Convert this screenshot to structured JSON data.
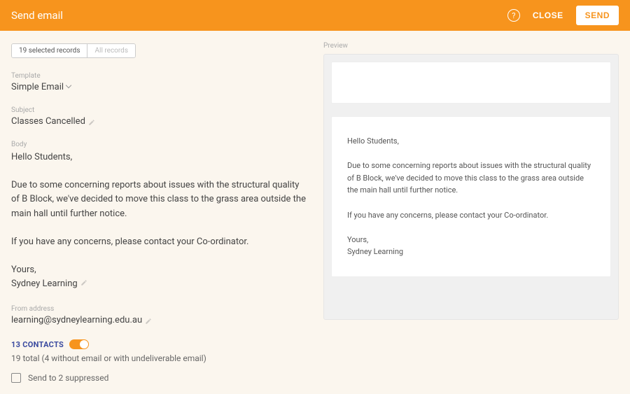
{
  "header": {
    "title": "Send email",
    "close_label": "CLOSE",
    "send_label": "SEND"
  },
  "tabs": {
    "selected": "19 selected records",
    "all": "All records"
  },
  "template": {
    "label": "Template",
    "value": "Simple Email"
  },
  "subject": {
    "label": "Subject",
    "value": "Classes Cancelled"
  },
  "body": {
    "label": "Body",
    "value": "Hello Students,\n\nDue to some concerning reports about issues with the structural quality of B Block, we've decided to move this class to the grass area outside the main hall until further notice.\n\nIf you have any concerns, please contact your Co-ordinator.\n\nYours,\nSydney Learning"
  },
  "from": {
    "label": "From address",
    "value": "learning@sydneylearning.edu.au"
  },
  "contacts": {
    "count_label": "13 CONTACTS",
    "note": "19 total (4 without email or with undeliverable email)",
    "suppressed_label": "Send to 2 suppressed"
  },
  "preview": {
    "label": "Preview",
    "body": "Hello Students,\n\nDue to some concerning reports about issues with the structural quality of B Block, we've decided to move this class to the grass area outside the main hall until further notice.\n\nIf you have any concerns, please contact your Co-ordinator.\n\nYours,\nSydney Learning"
  }
}
